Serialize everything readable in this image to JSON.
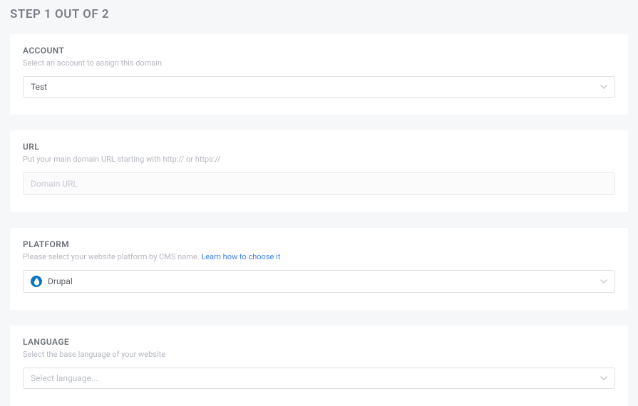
{
  "header": {
    "title": "STEP 1 OUT OF 2"
  },
  "account": {
    "label": "ACCOUNT",
    "hint": "Select an account to assign this domain",
    "selected": "Test"
  },
  "url": {
    "label": "URL",
    "hint": "Put your main domain URL starting with http:// or https://",
    "placeholder": "Domain URL",
    "value": ""
  },
  "platform": {
    "label": "PLATFORM",
    "hint_prefix": "Please select your website platform by CMS name.  ",
    "hint_link": "Learn how to choose it",
    "selected": "Drupal"
  },
  "language": {
    "label": "LANGUAGE",
    "hint": "Select the base language of your website",
    "placeholder": "Select language..."
  }
}
